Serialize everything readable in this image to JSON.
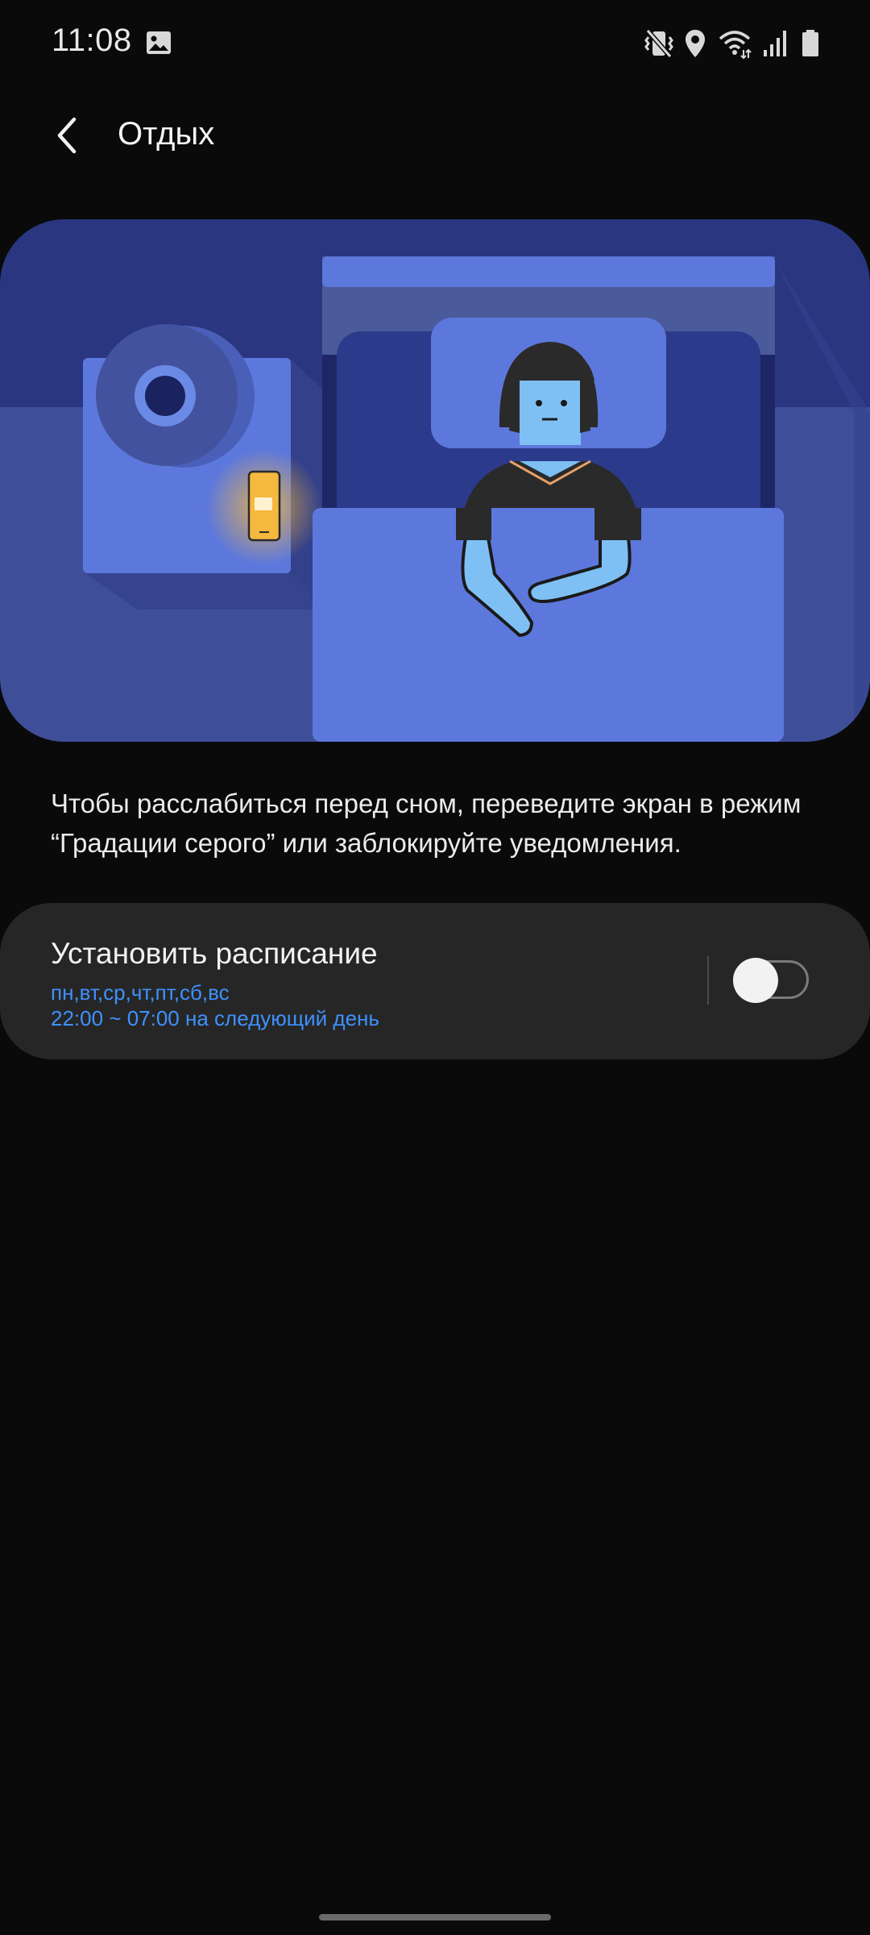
{
  "status_bar": {
    "time": "11:08",
    "left_icons": [
      "gallery-icon"
    ],
    "right_icons": [
      "vibrate-icon",
      "location-icon",
      "wifi-icon",
      "signal-icon",
      "battery-icon"
    ]
  },
  "header": {
    "back_icon": "chevron-left-icon",
    "title": "Отдых"
  },
  "illustration": {
    "subject": "person-sleeping-in-bed-with-phone-on-nightstand",
    "colors": {
      "wall": "#2a3680",
      "floor": "#3f4e99",
      "blanket": "#5d78dc",
      "glow": "#f7b83c"
    }
  },
  "description": "Чтобы расслабиться перед сном, переведите экран в режим “Градации серого” или заблокируйте уведомления.",
  "schedule": {
    "title": "Установить расписание",
    "days": "пн,вт,ср,чт,пт,сб,вс",
    "time": "22:00 ~ 07:00 на следующий день",
    "enabled": false
  },
  "theme": {
    "accent": "#3e91ff",
    "background": "#0a0a0a",
    "card": "#262626"
  }
}
